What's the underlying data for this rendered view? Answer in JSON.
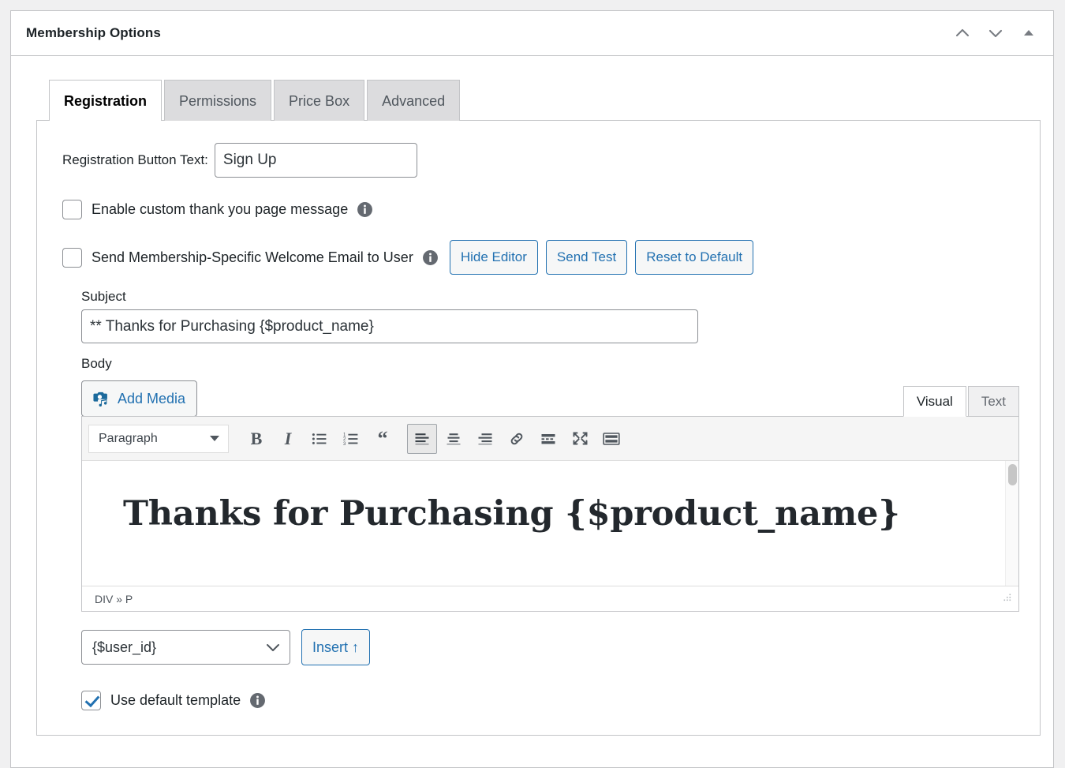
{
  "postbox": {
    "title": "Membership Options",
    "handles": [
      {
        "name": "move-up-icon",
        "glyph": "chevron-up"
      },
      {
        "name": "move-down-icon",
        "glyph": "chevron-down"
      },
      {
        "name": "toggle-panel-icon",
        "glyph": "triangle-up"
      }
    ]
  },
  "tabs": [
    {
      "label": "Registration",
      "active": true
    },
    {
      "label": "Permissions",
      "active": false
    },
    {
      "label": "Price Box",
      "active": false
    },
    {
      "label": "Advanced",
      "active": false
    }
  ],
  "registration": {
    "button_text_label": "Registration Button Text:",
    "button_text_value": "Sign Up",
    "button_text_placeholder": "",
    "thank_you": {
      "label": "Enable custom thank you page message",
      "checked": false
    },
    "welcome_email": {
      "label": "Send Membership-Specific Welcome Email to User",
      "checked": false,
      "actions": [
        "Hide Editor",
        "Send Test",
        "Reset to Default"
      ]
    },
    "subject": {
      "label": "Subject",
      "value": "** Thanks for Purchasing {$product_name}",
      "placeholder": ""
    },
    "body": {
      "label": "Body",
      "add_media_label": "Add Media",
      "editor_tabs": [
        {
          "label": "Visual",
          "active": true
        },
        {
          "label": "Text",
          "active": false
        }
      ],
      "toolbar": {
        "format_select": "Paragraph",
        "buttons": [
          {
            "name": "bold",
            "label": "B",
            "active": false
          },
          {
            "name": "italic",
            "label": "I",
            "active": false
          },
          {
            "name": "bulleted-list",
            "label": "",
            "active": false
          },
          {
            "name": "numbered-list",
            "label": "",
            "active": false
          },
          {
            "name": "blockquote",
            "label": "",
            "active": false
          },
          {
            "name": "align-left",
            "label": "",
            "active": true
          },
          {
            "name": "align-center",
            "label": "",
            "active": false
          },
          {
            "name": "align-right",
            "label": "",
            "active": false
          },
          {
            "name": "insert-link",
            "label": "",
            "active": false
          },
          {
            "name": "read-more",
            "label": "",
            "active": false
          },
          {
            "name": "fullscreen",
            "label": "",
            "active": false
          },
          {
            "name": "toolbar-toggle",
            "label": "",
            "active": false
          }
        ]
      },
      "content_heading": "Thanks for Purchasing {$product_name}",
      "path_status": "DIV » P"
    },
    "shortcode": {
      "selected": "{$user_id}",
      "insert_label": "Insert ↑"
    },
    "default_template": {
      "label": "Use default template",
      "checked": true
    }
  },
  "colors": {
    "accent": "#2271b1",
    "page_background": "#f0f0f1",
    "border": "#c3c4c7",
    "text": "#1d2327",
    "muted_text": "#50575e"
  }
}
